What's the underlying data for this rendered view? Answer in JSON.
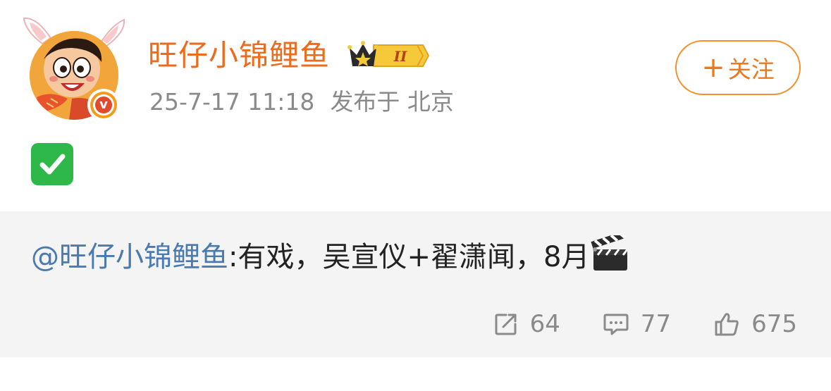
{
  "post": {
    "username": "旺仔小锦鲤鱼",
    "vip_level": "II",
    "timestamp": "25-7-17 11:18",
    "location": "发布于 北京",
    "follow_label": "关注",
    "follow_plus": "+",
    "status_emoji": "check-mark-button"
  },
  "repost": {
    "mention": "@旺仔小锦鲤鱼",
    "text": ":有戏，吴宣仪+翟潇闻，8月",
    "trailing_emoji": "clapper-board"
  },
  "actions": {
    "share_count": "64",
    "comment_count": "77",
    "like_count": "675"
  },
  "colors": {
    "username": "#ec6b1c",
    "mention": "#4a7ab0",
    "follow_border": "#f3902b",
    "meta_gray": "#8a8a8a",
    "repost_bg": "#f4f4f4"
  }
}
